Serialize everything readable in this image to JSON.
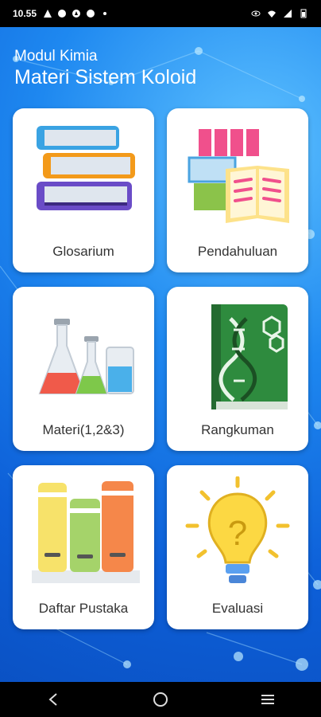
{
  "status": {
    "time": "10.55",
    "icons": [
      "warning-icon",
      "messenger-icon",
      "compass-icon",
      "messenger-icon",
      "dot-icon",
      "eye-icon",
      "wifi-icon",
      "signal-icon",
      "battery-icon"
    ]
  },
  "header": {
    "subtitle": "Modul Kimia",
    "title": "Materi Sistem Koloid"
  },
  "menu": {
    "items": [
      {
        "label": "Glosarium",
        "icon": "books-stack-icon"
      },
      {
        "label": "Pendahuluan",
        "icon": "open-book-icon"
      },
      {
        "label": "Materi(1,2&3)",
        "icon": "lab-flasks-icon"
      },
      {
        "label": "Rangkuman",
        "icon": "dna-book-icon"
      },
      {
        "label": "Daftar Pustaka",
        "icon": "bookshelf-icon"
      },
      {
        "label": "Evaluasi",
        "icon": "lightbulb-question-icon"
      }
    ]
  },
  "navbar": {
    "icons": [
      "back-icon",
      "home-icon",
      "recents-icon"
    ]
  },
  "colors": {
    "background": "#1e88f0",
    "card": "#ffffff",
    "text_header": "#ffffff",
    "text_card": "#333333"
  }
}
